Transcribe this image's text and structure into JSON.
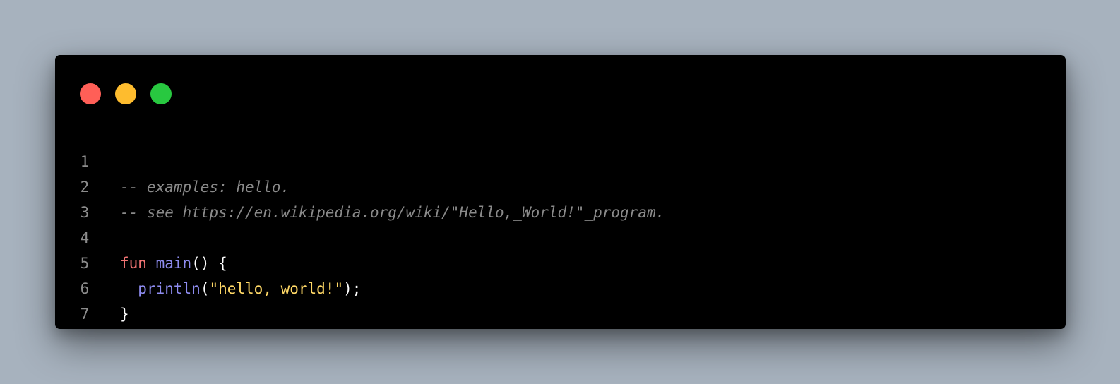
{
  "colors": {
    "background": "#a7b2be",
    "window": "#000000",
    "close_dot": "#ff5f57",
    "minimize_dot": "#febc2e",
    "maximize_dot": "#28c840",
    "line_number": "#8c8c8c",
    "comment": "#8a8a8a",
    "keyword": "#f47575",
    "function": "#8e8cf0",
    "string": "#ffd866",
    "plain": "#ffffff"
  },
  "window_controls": {
    "close": "close-icon",
    "minimize": "minimize-icon",
    "maximize": "maximize-icon"
  },
  "code": {
    "line_numbers": [
      "1",
      "2",
      "3",
      "4",
      "5",
      "6",
      "7"
    ],
    "line1_comment": "-- examples: hello.",
    "line2_comment": "-- see https://en.wikipedia.org/wiki/\"Hello,_World!\"_program.",
    "line4_keyword": "fun",
    "line4_space": " ",
    "line4_function": "main",
    "line4_rest": "() {",
    "line5_indent": "  ",
    "line5_function": "println",
    "line5_open": "(",
    "line5_string": "\"hello, world!\"",
    "line5_close": ");",
    "line6_brace": "}"
  }
}
